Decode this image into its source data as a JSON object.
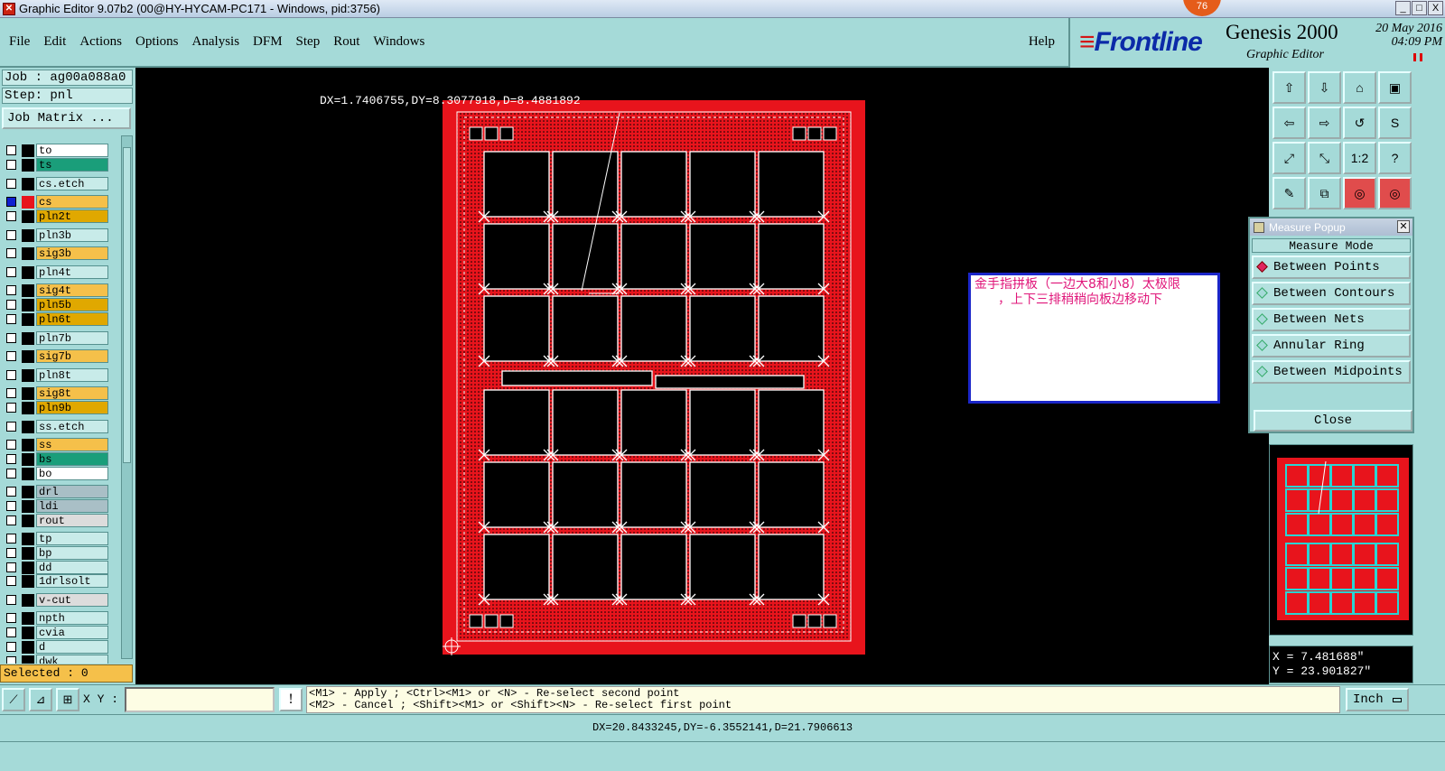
{
  "window": {
    "title": "Graphic Editor 9.07b2 (00@HY-HYCAM-PC171 - Windows, pid:3756)",
    "badge": "76",
    "controls": [
      "_",
      "□",
      "X"
    ]
  },
  "menu": {
    "items": [
      "File",
      "Edit",
      "Actions",
      "Options",
      "Analysis",
      "DFM",
      "Step",
      "Rout",
      "Windows"
    ],
    "help": "Help"
  },
  "brand": {
    "logo": "Frontline",
    "product": "Genesis 2000",
    "subtitle": "Graphic Editor",
    "date": "20 May 2016",
    "time": "04:09 PM"
  },
  "job": {
    "job_label": "Job : ag00a088a0",
    "step_label": "Step: pnl",
    "matrix_button": "Job Matrix ..."
  },
  "layers": [
    {
      "name": "to",
      "color": "#ffffff"
    },
    {
      "name": "ts",
      "color": "#1a9e7a"
    },
    {
      "name": "cs.etch",
      "color": "#c8ebe9"
    },
    {
      "name": "cs",
      "color": "#f5c04a",
      "active": true
    },
    {
      "name": "pln2t",
      "color": "#e0a800"
    },
    {
      "name": "pln3b",
      "color": "#c8ebe9"
    },
    {
      "name": "sig3b",
      "color": "#f5c04a"
    },
    {
      "name": "pln4t",
      "color": "#c8ebe9"
    },
    {
      "name": "sig4t",
      "color": "#f5c04a"
    },
    {
      "name": "pln5b",
      "color": "#e0a800"
    },
    {
      "name": "pln6t",
      "color": "#e0a800"
    },
    {
      "name": "pln7b",
      "color": "#c8ebe9"
    },
    {
      "name": "sig7b",
      "color": "#f5c04a"
    },
    {
      "name": "pln8t",
      "color": "#c8ebe9"
    },
    {
      "name": "sig8t",
      "color": "#f5c04a"
    },
    {
      "name": "pln9b",
      "color": "#e0a800"
    },
    {
      "name": "ss.etch",
      "color": "#c8ebe9"
    },
    {
      "name": "ss",
      "color": "#f5c04a"
    },
    {
      "name": "bs",
      "color": "#1a9e7a"
    },
    {
      "name": "bo",
      "color": "#ffffff"
    },
    {
      "name": "drl",
      "color": "#a9bfc6"
    },
    {
      "name": "ldi",
      "color": "#a9bfc6"
    },
    {
      "name": "rout",
      "color": "#dcdcdc"
    },
    {
      "name": "tp",
      "color": "#c8ebe9"
    },
    {
      "name": "bp",
      "color": "#c8ebe9"
    },
    {
      "name": "dd",
      "color": "#c8ebe9"
    },
    {
      "name": "1drlsolt",
      "color": "#c8ebe9"
    },
    {
      "name": "v-cut",
      "color": "#dcdcdc"
    },
    {
      "name": "npth",
      "color": "#c8ebe9"
    },
    {
      "name": "cvia",
      "color": "#c8ebe9"
    },
    {
      "name": "d",
      "color": "#c8ebe9"
    },
    {
      "name": "dwk",
      "color": "#c8ebe9"
    }
  ],
  "selected": "Selected : 0",
  "canvas": {
    "measure_text": "DX=1.7406755,DY=8.3077918,D=8.4881892"
  },
  "note": {
    "line1": "金手指拼板（一边大8和小8）太极限",
    "line2": "，上下三排稍稍向板边移动下"
  },
  "toolbox": [
    "⇧",
    "⇩",
    "⌂",
    "▣",
    "⇦",
    "⇨",
    "↺",
    "S",
    "⤢",
    "⤡",
    "1:2",
    "?",
    "✎",
    "⧉",
    "◎",
    "◎"
  ],
  "measure_popup": {
    "title": "Measure Popup",
    "header": "Measure Mode",
    "options": [
      {
        "label": "Between Points",
        "selected": true
      },
      {
        "label": "Between Contours",
        "selected": false
      },
      {
        "label": "Between Nets",
        "selected": false
      },
      {
        "label": "Annular Ring",
        "selected": false
      },
      {
        "label": "Between Midpoints",
        "selected": false
      }
    ],
    "close": "Close"
  },
  "coords": {
    "x": "X = 7.481688\"",
    "y": "Y = 23.901827\""
  },
  "bottom": {
    "xy_label": "X Y :",
    "xy_value": "",
    "excl": "!",
    "hint1": "<M1> - Apply  ; <Ctrl><M1> or <N> - Re-select second point",
    "hint2": "<M2> - Cancel ; <Shift><M1> or <Shift><N> - Re-select first point",
    "unit": "Inch",
    "status": "DX=20.8433245,DY=-6.3552141,D=21.7906613"
  },
  "colors": {
    "panel": "#a5dad8",
    "board": "#e8141c",
    "note_border": "#1b26c9",
    "note_text": "#e0167a"
  }
}
